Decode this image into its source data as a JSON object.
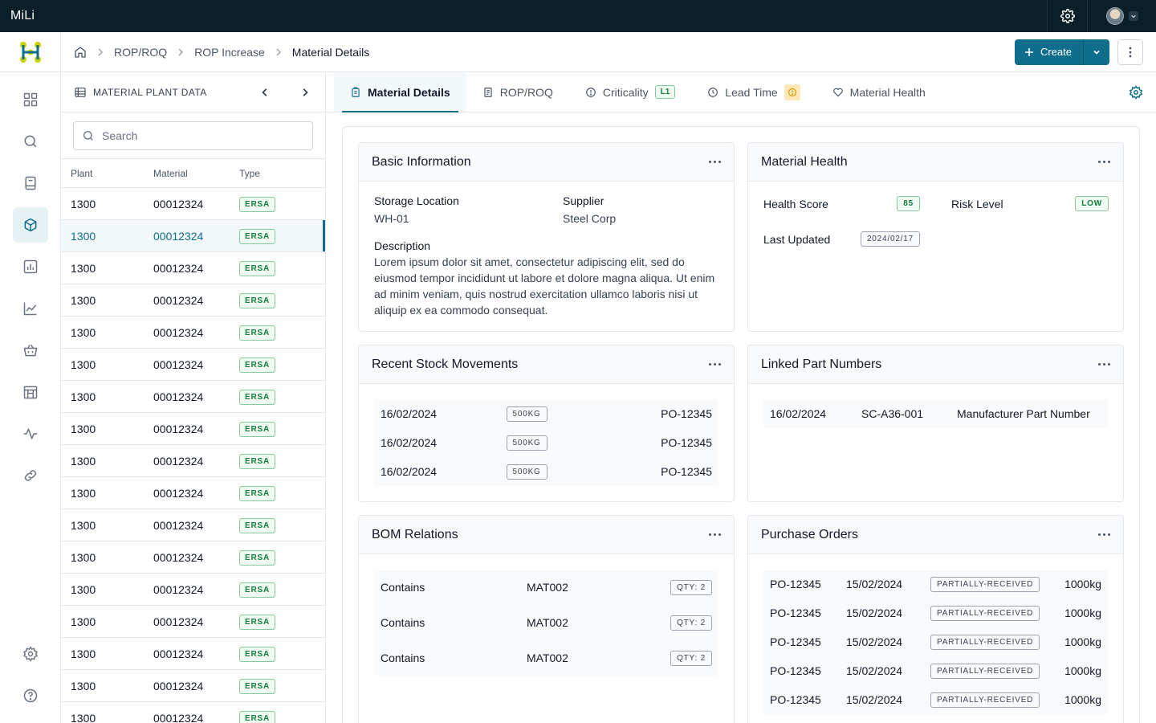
{
  "app": {
    "brand": "MiLi"
  },
  "breadcrumb": [
    "ROP/ROQ",
    "ROP Increase",
    "Material Details"
  ],
  "header": {
    "create_label": "Create"
  },
  "panel": {
    "title": "MATERIAL PLANT DATA",
    "search_placeholder": "Search",
    "columns": {
      "plant": "Plant",
      "material": "Material",
      "type": "Type"
    },
    "rows": [
      {
        "plant": "1300",
        "material": "00012324",
        "type": "ERSA"
      },
      {
        "plant": "1300",
        "material": "00012324",
        "type": "ERSA"
      },
      {
        "plant": "1300",
        "material": "00012324",
        "type": "ERSA"
      },
      {
        "plant": "1300",
        "material": "00012324",
        "type": "ERSA"
      },
      {
        "plant": "1300",
        "material": "00012324",
        "type": "ERSA"
      },
      {
        "plant": "1300",
        "material": "00012324",
        "type": "ERSA"
      },
      {
        "plant": "1300",
        "material": "00012324",
        "type": "ERSA"
      },
      {
        "plant": "1300",
        "material": "00012324",
        "type": "ERSA"
      },
      {
        "plant": "1300",
        "material": "00012324",
        "type": "ERSA"
      },
      {
        "plant": "1300",
        "material": "00012324",
        "type": "ERSA"
      },
      {
        "plant": "1300",
        "material": "00012324",
        "type": "ERSA"
      },
      {
        "plant": "1300",
        "material": "00012324",
        "type": "ERSA"
      },
      {
        "plant": "1300",
        "material": "00012324",
        "type": "ERSA"
      },
      {
        "plant": "1300",
        "material": "00012324",
        "type": "ERSA"
      },
      {
        "plant": "1300",
        "material": "00012324",
        "type": "ERSA"
      },
      {
        "plant": "1300",
        "material": "00012324",
        "type": "ERSA"
      },
      {
        "plant": "1300",
        "material": "00012324",
        "type": "ERSA"
      }
    ],
    "selected_index": 1
  },
  "tabs": [
    {
      "label": "Material Details"
    },
    {
      "label": "ROP/ROQ"
    },
    {
      "label": "Criticality",
      "badge": "L1"
    },
    {
      "label": "Lead Time"
    },
    {
      "label": "Material Health"
    }
  ],
  "basic_info": {
    "title": "Basic Information",
    "storage_location_label": "Storage Location",
    "storage_location": "WH-01",
    "supplier_label": "Supplier",
    "supplier": "Steel Corp",
    "description_label": "Description",
    "description": "Lorem ipsum dolor sit amet, consectetur adipiscing elit, sed do eiusmod tempor incididunt ut labore et dolore magna aliqua. Ut enim ad minim veniam, quis nostrud exercitation ullamco laboris nisi ut aliquip ex ea commodo consequat."
  },
  "health": {
    "title": "Material Health",
    "score_label": "Health Score",
    "score": "85",
    "risk_label": "Risk Level",
    "risk": "LOW",
    "updated_label": "Last Updated",
    "updated": "2024/02/17"
  },
  "stock": {
    "title": "Recent Stock Movements",
    "rows": [
      {
        "date": "16/02/2024",
        "qty": "500KG",
        "po": "PO-12345"
      },
      {
        "date": "16/02/2024",
        "qty": "500KG",
        "po": "PO-12345"
      },
      {
        "date": "16/02/2024",
        "qty": "500KG",
        "po": "PO-12345"
      }
    ]
  },
  "linked": {
    "title": "Linked Part Numbers",
    "rows": [
      {
        "date": "16/02/2024",
        "part": "SC-A36-001",
        "kind": "Manufacturer Part Number"
      }
    ]
  },
  "bom": {
    "title": "BOM Relations",
    "rows": [
      {
        "relation": "Contains",
        "material": "MAT002",
        "qty": "QTY: 2"
      },
      {
        "relation": "Contains",
        "material": "MAT002",
        "qty": "QTY: 2"
      },
      {
        "relation": "Contains",
        "material": "MAT002",
        "qty": "QTY: 2"
      }
    ]
  },
  "po": {
    "title": "Purchase Orders",
    "rows": [
      {
        "po": "PO-12345",
        "date": "15/02/2024",
        "status": "PARTIALLY-RECEIVED",
        "qty": "1000kg"
      },
      {
        "po": "PO-12345",
        "date": "15/02/2024",
        "status": "PARTIALLY-RECEIVED",
        "qty": "1000kg"
      },
      {
        "po": "PO-12345",
        "date": "15/02/2024",
        "status": "PARTIALLY-RECEIVED",
        "qty": "1000kg"
      },
      {
        "po": "PO-12345",
        "date": "15/02/2024",
        "status": "PARTIALLY-RECEIVED",
        "qty": "1000kg"
      },
      {
        "po": "PO-12345",
        "date": "15/02/2024",
        "status": "PARTIALLY-RECEIVED",
        "qty": "1000kg"
      }
    ]
  },
  "colors": {
    "accent": "#0f6e8c",
    "topbar": "#0b1f2a",
    "success": "#15803d",
    "warning": "#f0b429"
  },
  "icons": {
    "rail": [
      "grid-icon",
      "search-icon",
      "book-icon",
      "cube-icon",
      "bar-chart-icon",
      "line-chart-icon",
      "basket-icon",
      "store-icon",
      "activity-icon",
      "link-icon",
      "settings-icon",
      "help-icon"
    ]
  }
}
